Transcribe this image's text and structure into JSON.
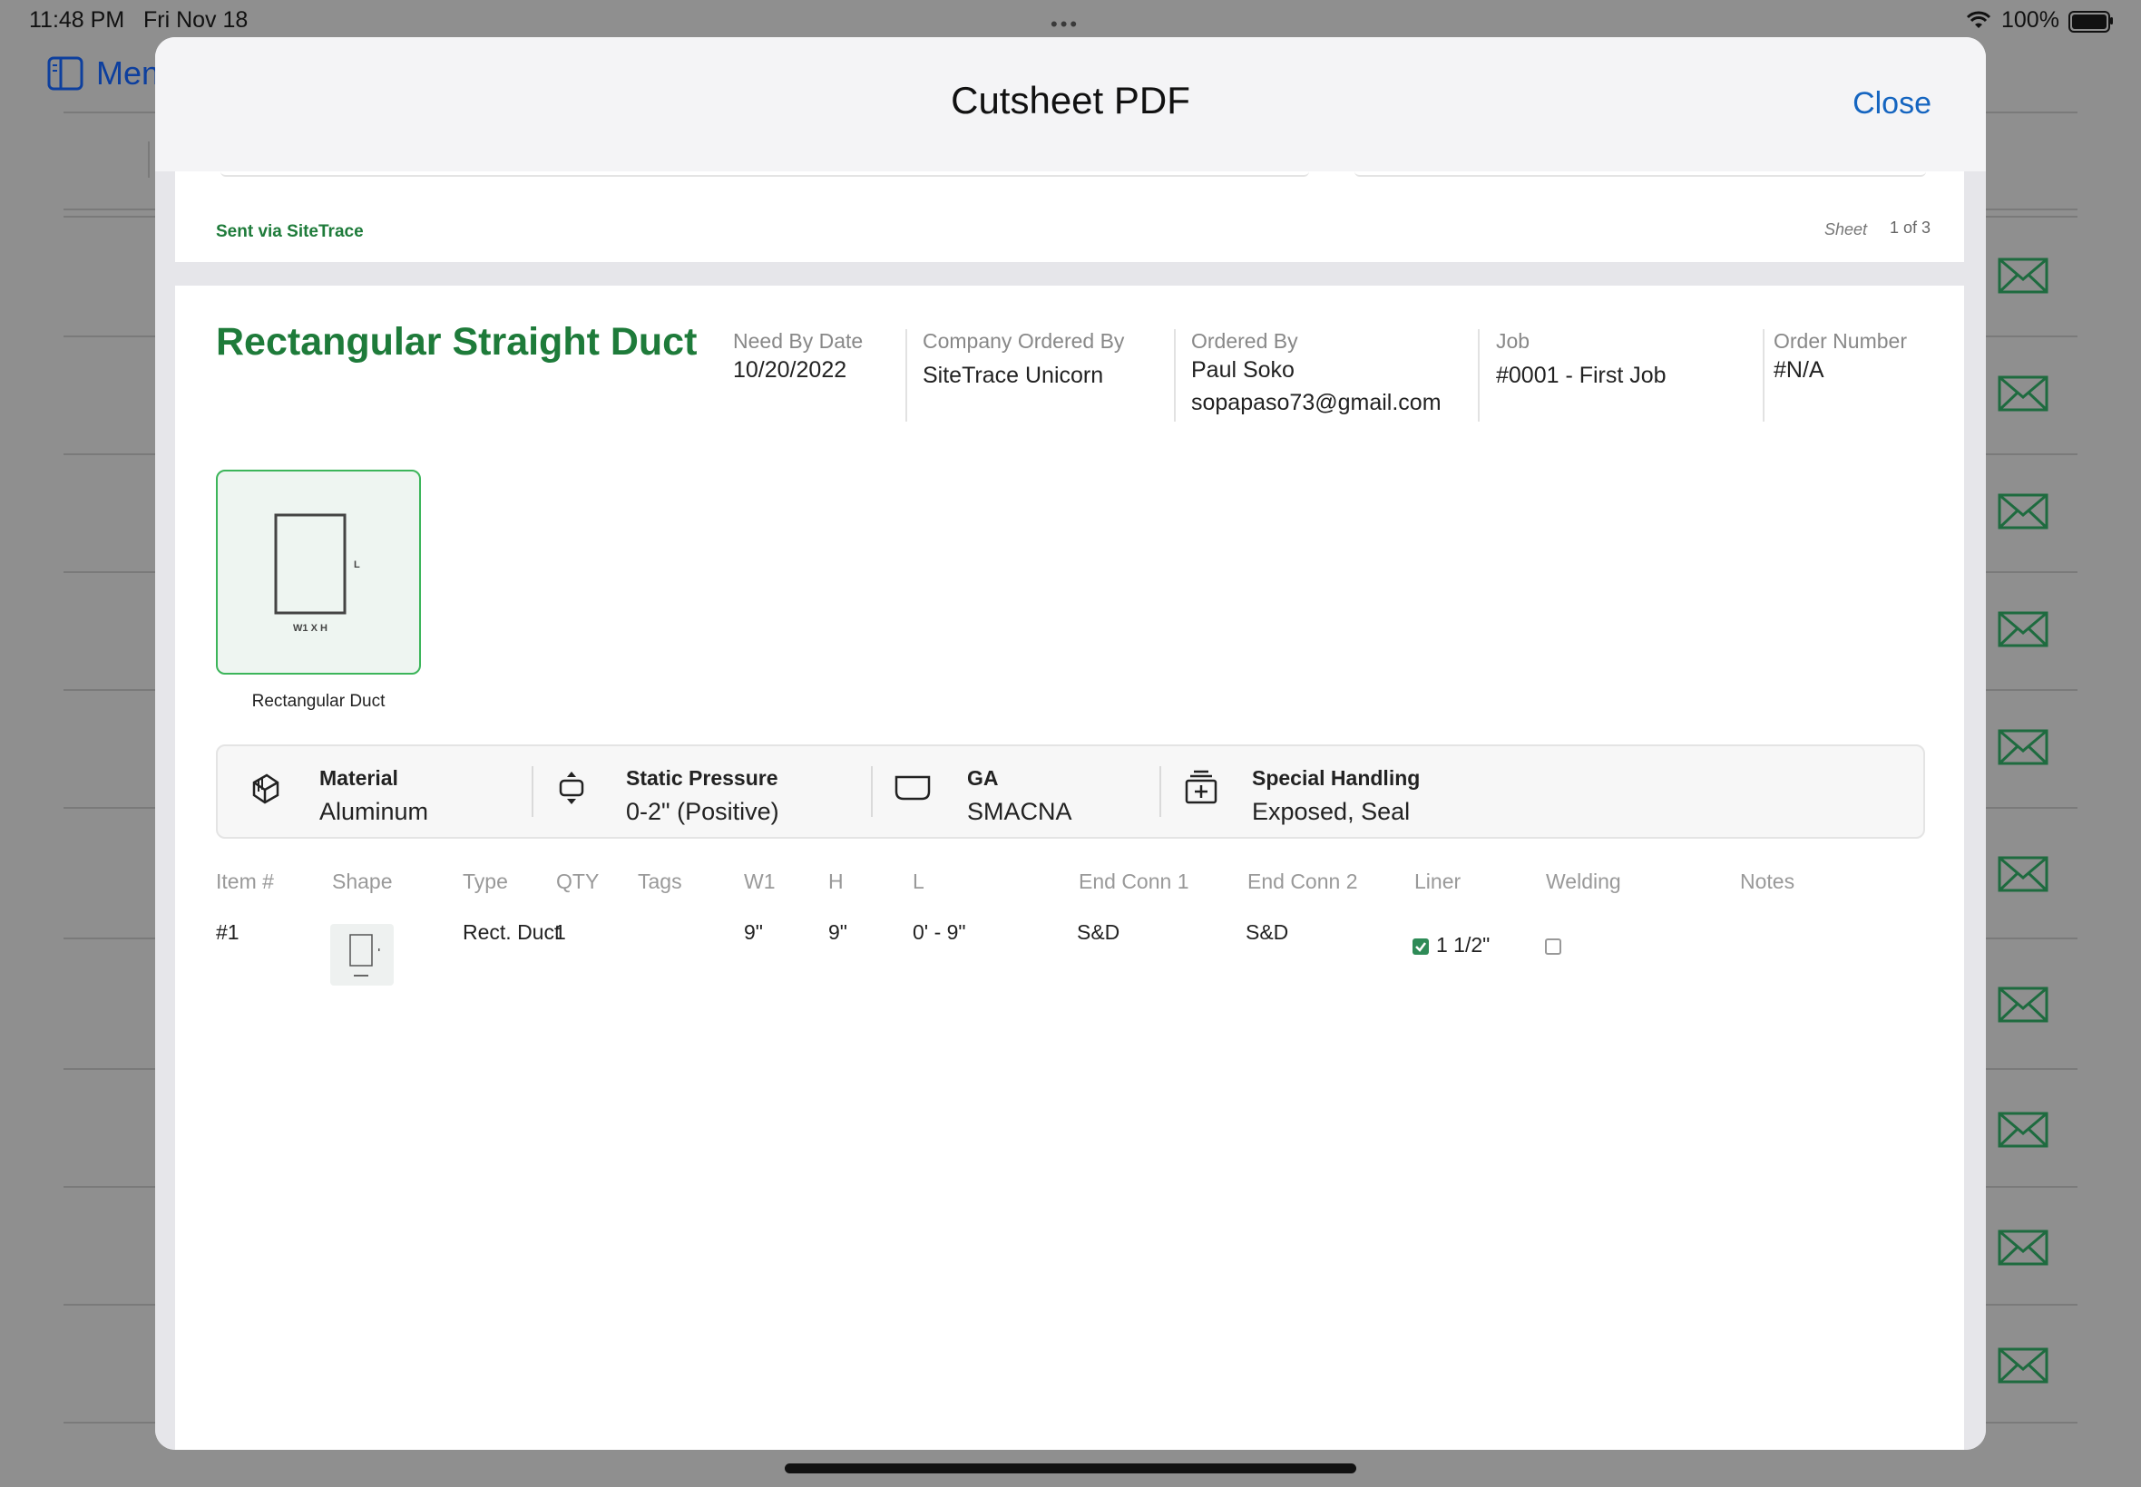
{
  "status_bar": {
    "time": "11:48 PM",
    "date": "Fri Nov 18",
    "battery": "100%",
    "dots": "•••"
  },
  "background": {
    "menu_label": "Menu",
    "mail_icons": 10
  },
  "modal": {
    "title": "Cutsheet PDF",
    "close_label": "Close"
  },
  "previous_page": {
    "sent_via": "Sent via SiteTrace",
    "sheet_label": "Sheet",
    "sheet_value": "1 of 3"
  },
  "order": {
    "title": "Rectangular Straight Duct",
    "fields": [
      {
        "label": "Need By Date",
        "value": "10/20/2022"
      },
      {
        "label": "Company Ordered By",
        "value": "SiteTrace Unicorn"
      },
      {
        "label": "Ordered By",
        "value": "Paul Soko",
        "value2": "sopapaso73@gmail.com"
      },
      {
        "label": "Job",
        "value": "#0001 - First Job"
      },
      {
        "label": "Order Number",
        "value": "#N/A"
      }
    ],
    "thumbnail": {
      "caption": "Rectangular Duct",
      "dim_w": "W1 X H",
      "dim_l": "L"
    },
    "specs": [
      {
        "label": "Material",
        "value": "Aluminum",
        "icon": "layers-icon"
      },
      {
        "label": "Static Pressure",
        "value": "0-2\" (Positive)",
        "icon": "pressure-icon"
      },
      {
        "label": "GA",
        "value": "SMACNA",
        "icon": "gauge-icon"
      },
      {
        "label": "Special Handling",
        "value": "Exposed, Seal",
        "icon": "handling-icon"
      }
    ],
    "table": {
      "headers": [
        "Item #",
        "Shape",
        "Type",
        "QTY",
        "Tags",
        "W1",
        "H",
        "L",
        "End Conn 1",
        "End Conn 2",
        "Liner",
        "Welding",
        "Notes"
      ],
      "rows": [
        {
          "item": "#1",
          "type": "Rect. Duct",
          "qty": "1",
          "tags": "",
          "w1": "9\"",
          "h": "9\"",
          "l": "0' - 9\"",
          "end1": "S&D",
          "end2": "S&D",
          "liner": "1 1/2\"",
          "liner_checked": true,
          "welding_checked": false,
          "notes": ""
        }
      ]
    }
  },
  "colors": {
    "accent_green": "#1e7b3a",
    "link_blue": "#1565c0",
    "thumb_border": "#3cb55a"
  }
}
